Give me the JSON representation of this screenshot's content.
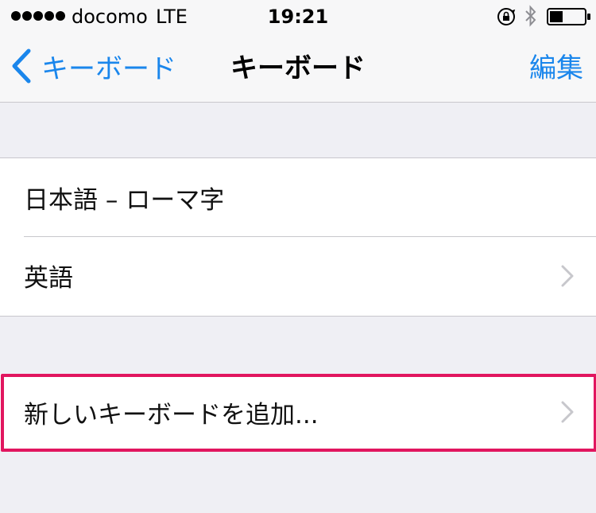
{
  "status_bar": {
    "carrier": "docomo",
    "network": "LTE",
    "time": "19:21"
  },
  "nav": {
    "back_label": "キーボード",
    "title": "キーボード",
    "edit_label": "編集"
  },
  "keyboards": [
    {
      "label": "日本語 – ローマ字",
      "has_chevron": false
    },
    {
      "label": "英語",
      "has_chevron": true
    }
  ],
  "add_keyboard": {
    "label": "新しいキーボードを追加...",
    "has_chevron": true
  },
  "colors": {
    "accent": "#1a86ec",
    "highlight": "#e1165f",
    "background": "#efeff4",
    "separator": "#c8c7cc"
  }
}
